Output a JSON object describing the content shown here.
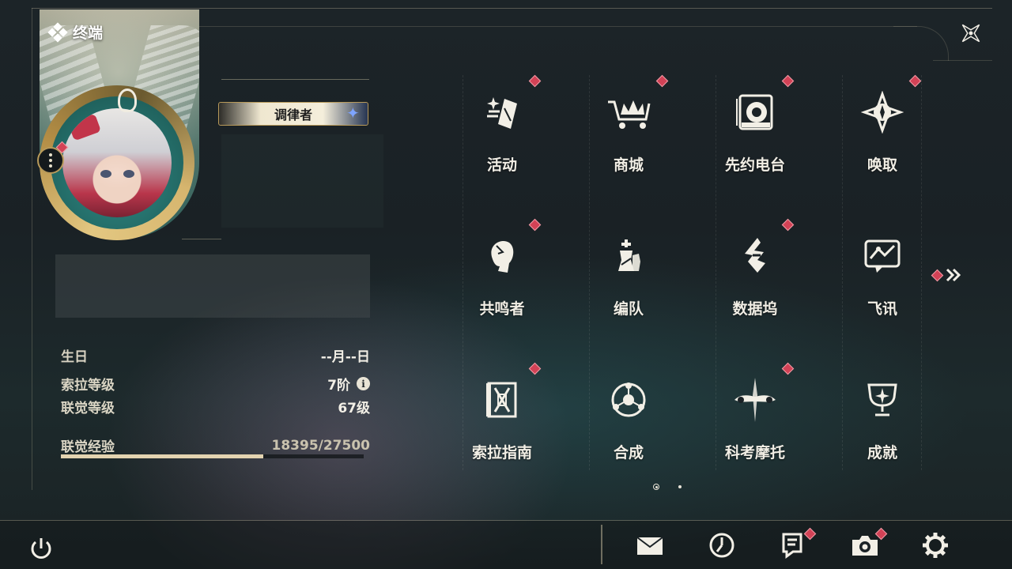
{
  "header": {
    "title": "终端"
  },
  "profile": {
    "title_badge": "调律者",
    "stats": [
      {
        "label": "生日",
        "value": "--月--日"
      },
      {
        "label": "索拉等级",
        "value": "7阶"
      },
      {
        "label": "联觉等级",
        "value": "67级"
      }
    ],
    "exp": {
      "label": "联觉经验",
      "value": "18395/27500",
      "progress": 0.669
    }
  },
  "menu": {
    "items": [
      {
        "label": "活动",
        "icon": "event-icon",
        "badge": true
      },
      {
        "label": "商城",
        "icon": "shop-crown-icon",
        "badge": true
      },
      {
        "label": "先约电台",
        "icon": "radio-icon",
        "badge": true
      },
      {
        "label": "唤取",
        "icon": "convene-star-icon",
        "badge": true
      },
      {
        "label": "共鸣者",
        "icon": "resonator-head-icon",
        "badge": true
      },
      {
        "label": "编队",
        "icon": "team-chess-icon",
        "badge": false
      },
      {
        "label": "数据坞",
        "icon": "data-bank-icon",
        "badge": true
      },
      {
        "label": "飞讯",
        "icon": "chat-bubble-icon",
        "badge": false
      },
      {
        "label": "索拉指南",
        "icon": "guidebook-icon",
        "badge": true
      },
      {
        "label": "合成",
        "icon": "synthesis-icon",
        "badge": false
      },
      {
        "label": "科考摩托",
        "icon": "motorbike-icon",
        "badge": true
      },
      {
        "label": "成就",
        "icon": "trophy-icon",
        "badge": false
      }
    ],
    "page": {
      "current": 1,
      "total": 2
    }
  },
  "bottom_bar": {
    "buttons": [
      {
        "name": "mail",
        "icon": "mail-icon",
        "badge": false
      },
      {
        "name": "clock",
        "icon": "clock-icon",
        "badge": false
      },
      {
        "name": "notice",
        "icon": "notice-icon",
        "badge": true
      },
      {
        "name": "camera",
        "icon": "camera-icon",
        "badge": true
      },
      {
        "name": "settings",
        "icon": "gear-icon",
        "badge": false
      }
    ]
  },
  "colors": {
    "accent_gold": "#b89a5a",
    "badge_red": "#d24256",
    "text": "#f1eee5"
  }
}
